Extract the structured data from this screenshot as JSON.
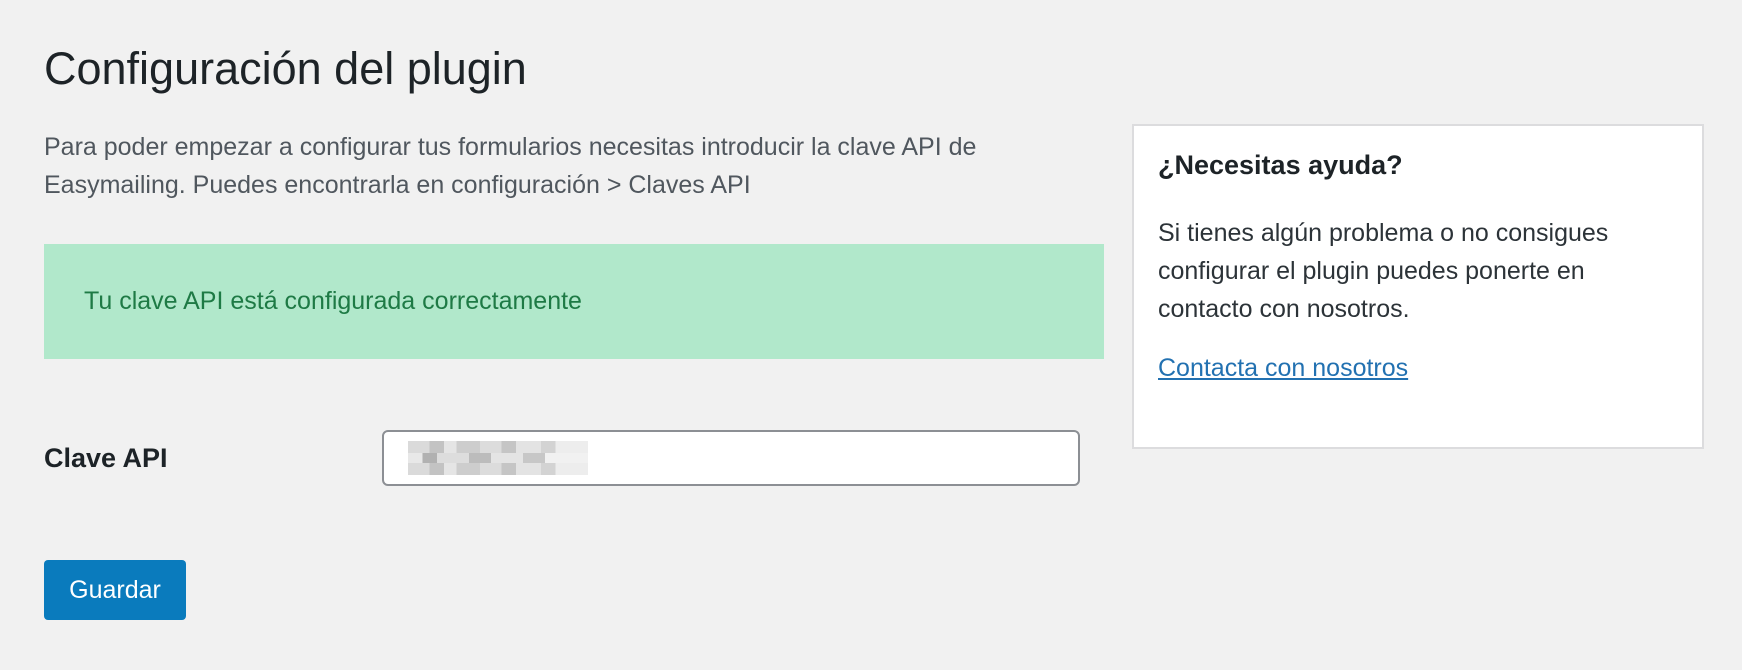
{
  "page": {
    "title": "Configuración del plugin",
    "intro": "Para poder empezar a configurar tus formularios necesitas introducir la clave API de Easymailing. Puedes encontrarla en configuración > Claves API"
  },
  "notice": {
    "text": "Tu clave API está configurada correctamente",
    "status": "success",
    "color": "#b1e8cb"
  },
  "form": {
    "api_key_label": "Clave API",
    "api_key_value": "",
    "api_key_masked": true,
    "save_label": "Guardar"
  },
  "help": {
    "title": "¿Necesitas ayuda?",
    "text": "Si tienes algún problema o no consigues configurar el plugin puedes ponerte en contacto con nosotros.",
    "link_label": "Contacta con nosotros"
  },
  "colors": {
    "primary_button": "#0a7bbd",
    "link": "#2271b1",
    "background": "#f1f1f1"
  }
}
